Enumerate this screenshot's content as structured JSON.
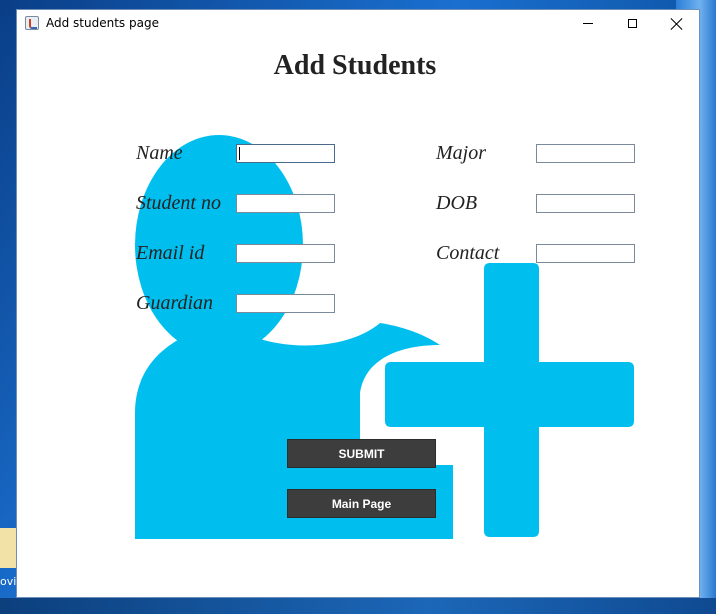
{
  "window": {
    "title": "Add students page"
  },
  "page": {
    "title": "Add Students"
  },
  "form": {
    "fields": [
      {
        "label": "Name",
        "value": ""
      },
      {
        "label": "Student no",
        "value": ""
      },
      {
        "label": "Email id",
        "value": ""
      },
      {
        "label": "Guardian",
        "value": ""
      },
      {
        "label": "Major",
        "value": ""
      },
      {
        "label": "DOB",
        "value": ""
      },
      {
        "label": "Contact",
        "value": ""
      }
    ],
    "submit_label": "SUBMIT",
    "main_page_label": "Main Page"
  },
  "desktop": {
    "icon_label": "ovie"
  },
  "colors": {
    "accent_graphic": "#00bfee",
    "button_bg": "#3d3d3d"
  },
  "icons": {
    "background": "add-user-icon",
    "app": "java-cup-icon"
  }
}
